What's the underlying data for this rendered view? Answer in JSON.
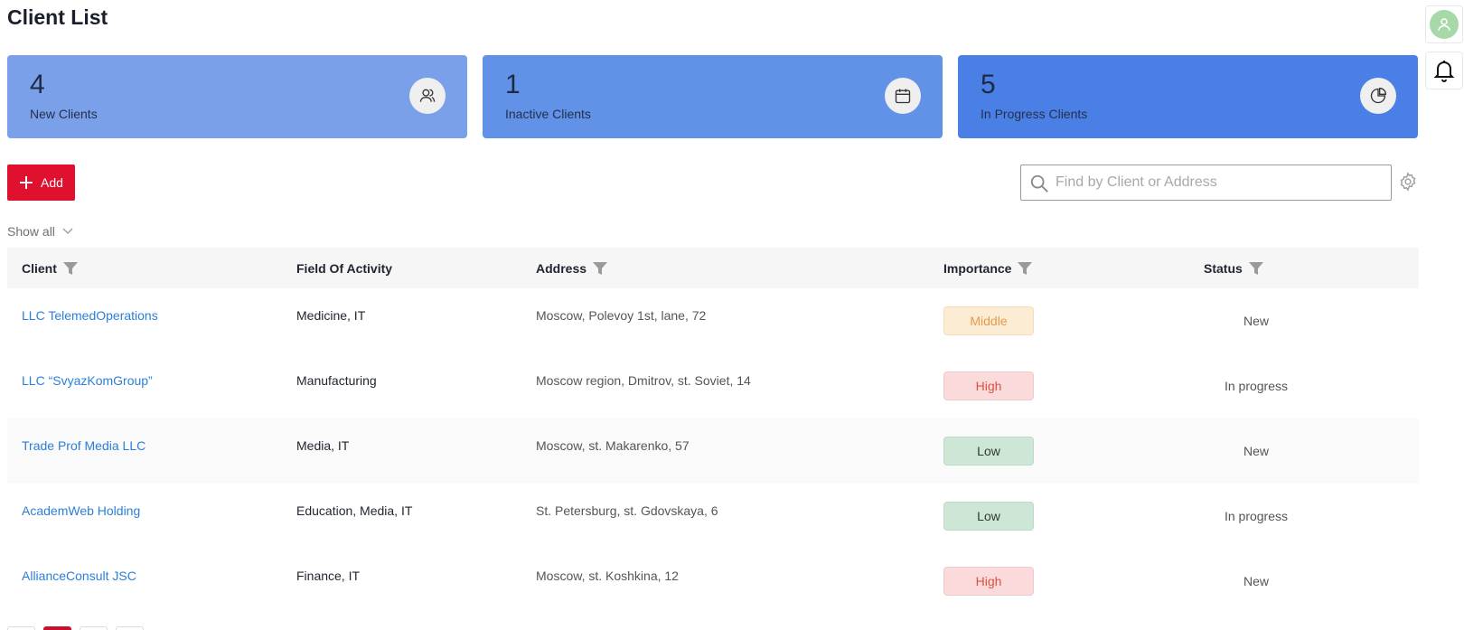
{
  "header": {
    "title": "Client List"
  },
  "right_rail": {
    "avatar_icon": "user-icon",
    "bell_icon": "bell-icon"
  },
  "stats": [
    {
      "value": "4",
      "label": "New Clients",
      "icon": "users-icon"
    },
    {
      "value": "1",
      "label": "Inactive Clients",
      "icon": "calendar-icon"
    },
    {
      "value": "5",
      "label": "In Progress Clients",
      "icon": "pie-chart-icon"
    }
  ],
  "toolbar": {
    "add_label": "Add",
    "search_placeholder": "Find by Client or Address",
    "filter_label": "Show all"
  },
  "table": {
    "columns": [
      "Client",
      "Field Of Activity",
      "Address",
      "Importance",
      "Status"
    ],
    "rows": [
      {
        "client": "LLC TelemedOperations",
        "field": "Medicine, IT",
        "address": "Moscow, Polevoy 1st, lane, 72",
        "importance": "Middle",
        "status": "New"
      },
      {
        "client": "LLC “SvyazKomGroup”",
        "field": "Manufacturing",
        "address": "Moscow region, Dmitrov, st. Soviet, 14",
        "importance": "High",
        "status": "In progress"
      },
      {
        "client": "Trade Prof Media LLC",
        "field": "Media, IT",
        "address": "Moscow, st. Makarenko, 57",
        "importance": "Low",
        "status": "New"
      },
      {
        "client": "AcademWeb Holding",
        "field": "Education, Media, IT",
        "address": "St. Petersburg, st. Gdovskaya, 6",
        "importance": "Low",
        "status": "In progress"
      },
      {
        "client": "AllianceConsult JSC",
        "field": "Finance, IT",
        "address": "Moscow, st. Koshkina, 12",
        "importance": "High",
        "status": "New"
      }
    ]
  },
  "colors": {
    "accent_red": "#e0102f",
    "link_blue": "#2b7fd8",
    "card_1": "#7aa0ea",
    "card_2": "#6291e8",
    "card_3": "#4a80e6"
  }
}
